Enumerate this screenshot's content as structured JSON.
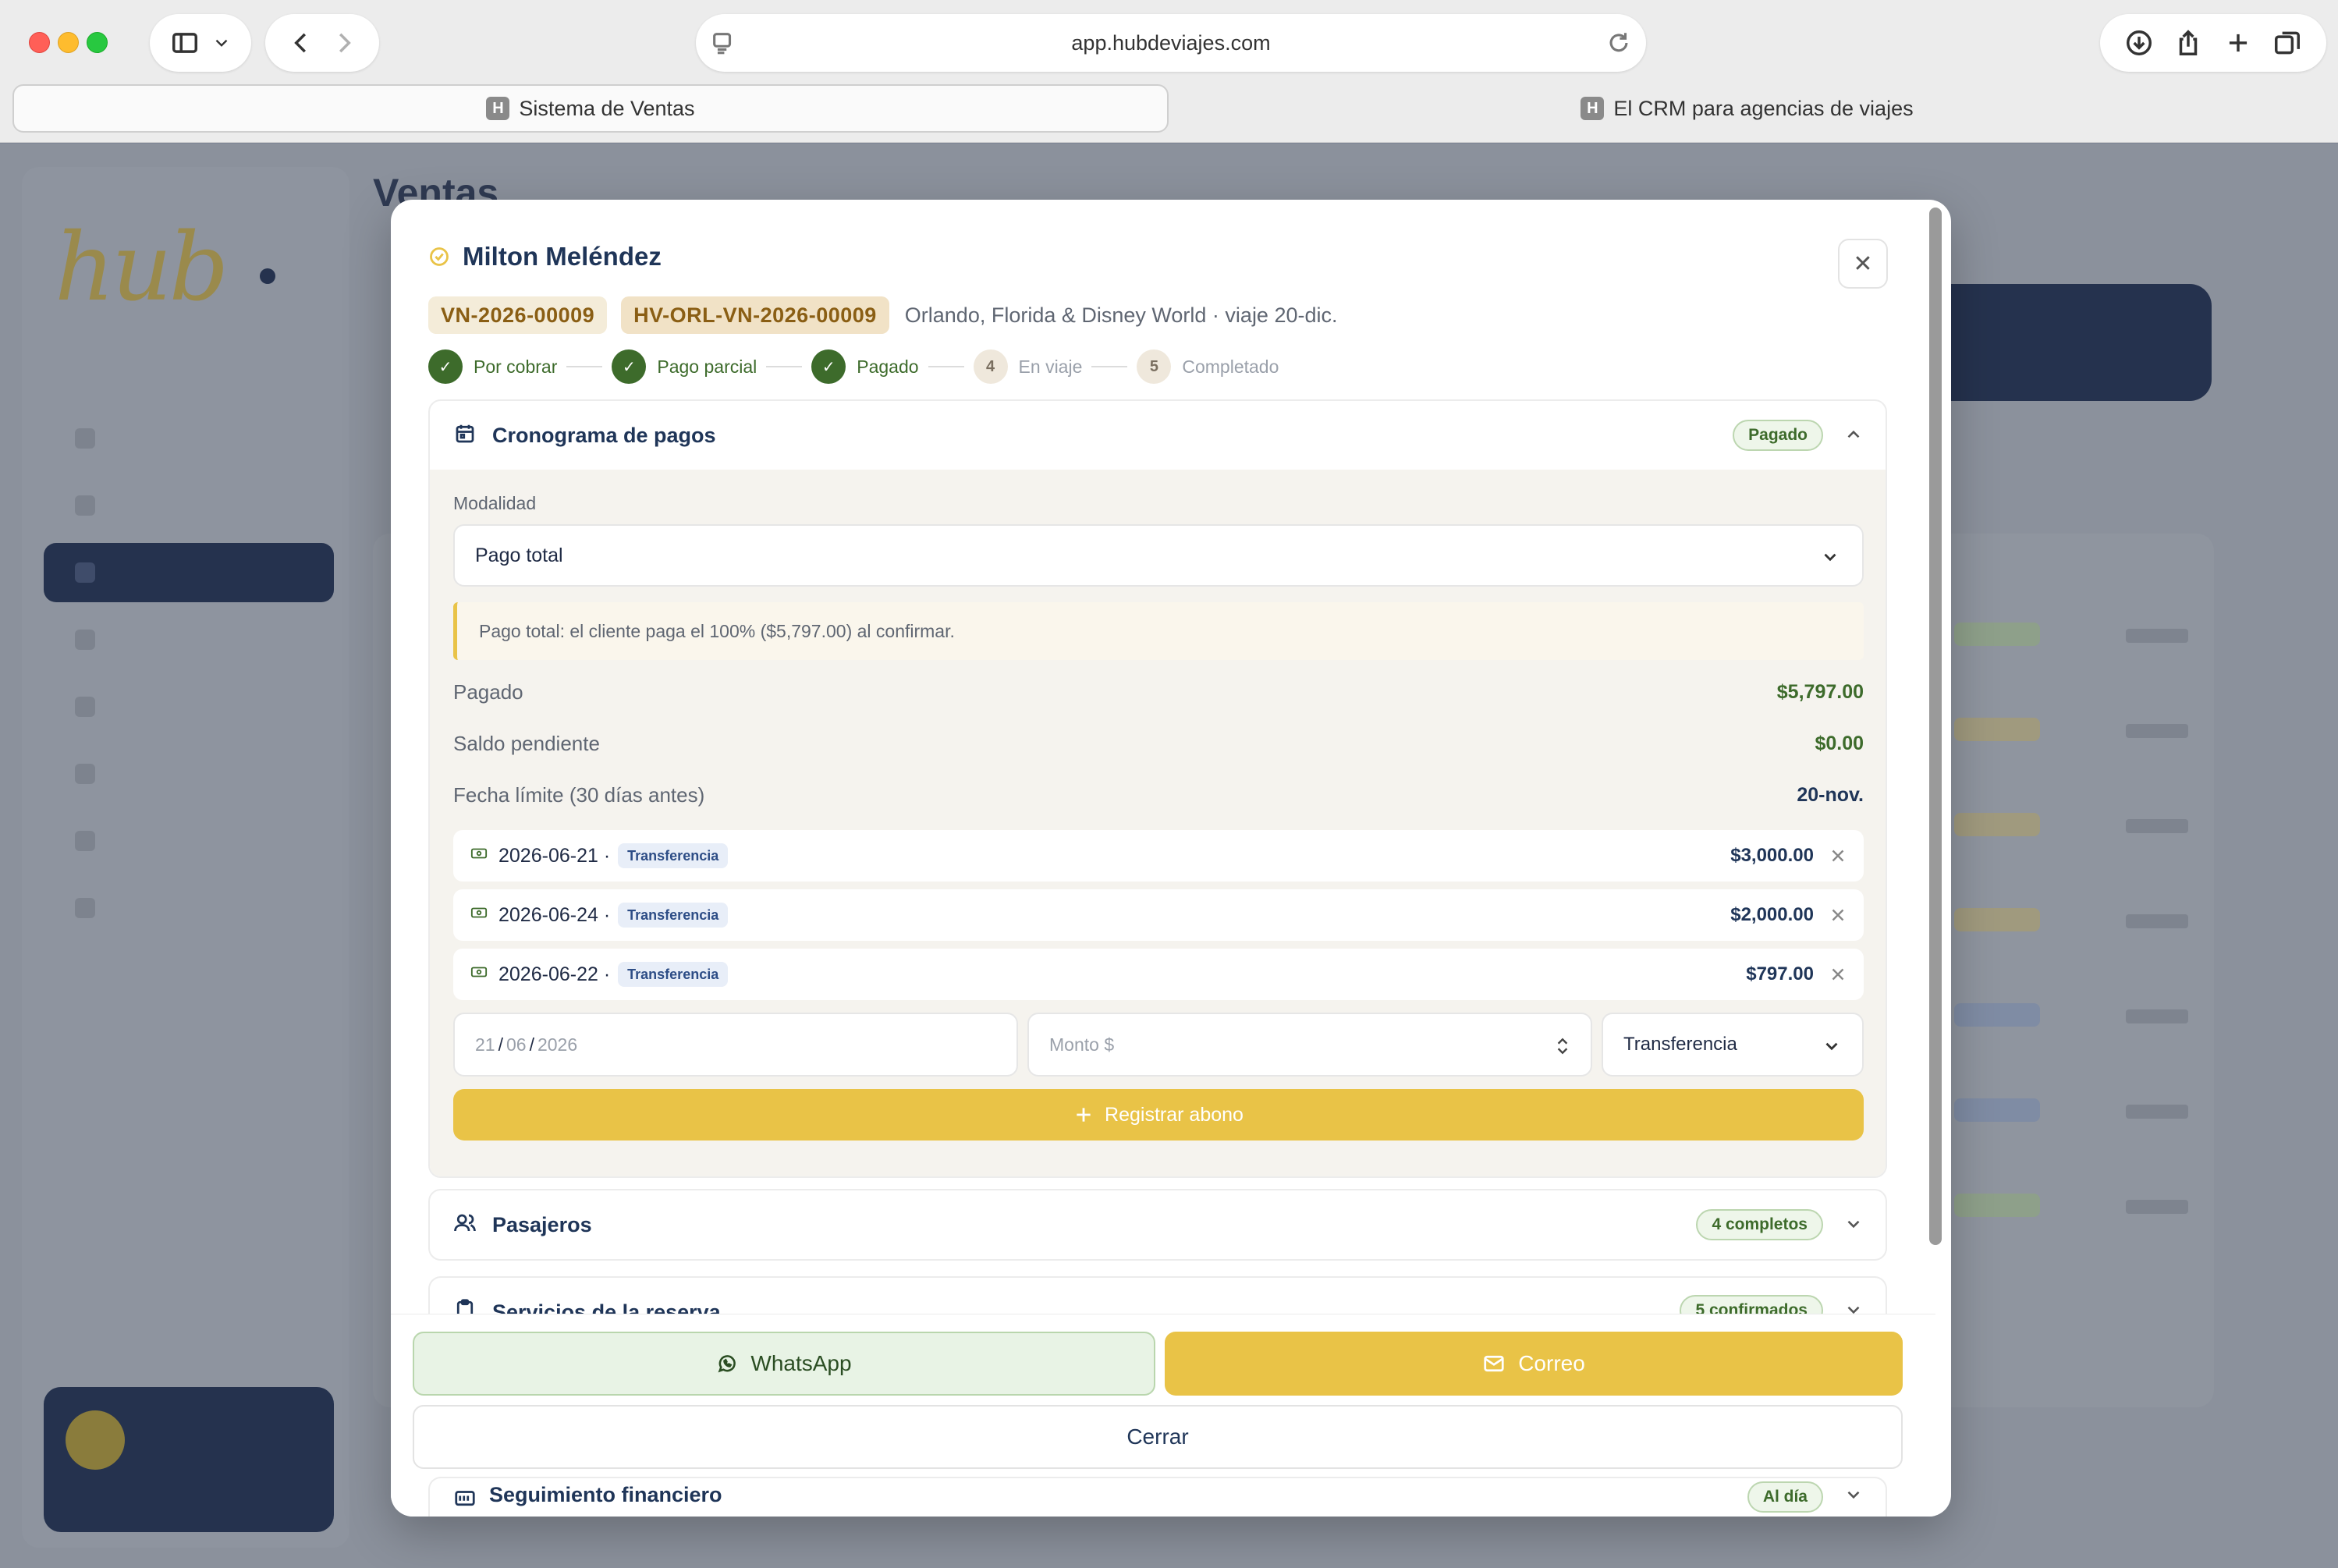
{
  "browser": {
    "url": "app.hubdeviajes.com",
    "tabs": [
      {
        "label": "Sistema de Ventas",
        "favicon": "H"
      },
      {
        "label": "El CRM para agencias de viajes",
        "favicon": "H"
      }
    ]
  },
  "background_app": {
    "logo_text": "hub",
    "page_title": "Ventas",
    "accent": "#25324e",
    "gold": "#e9c347"
  },
  "modal": {
    "client_name": "Milton Meléndez",
    "codes": [
      "VN-2026-00009",
      "HV-ORL-VN-2026-00009"
    ],
    "trip_description": "Orlando, Florida & Disney World · viaje 20-dic.",
    "steps": [
      {
        "number": "1",
        "label": "Por cobrar",
        "state": "done"
      },
      {
        "number": "2",
        "label": "Pago parcial",
        "state": "done"
      },
      {
        "number": "3",
        "label": "Pagado",
        "state": "done"
      },
      {
        "number": "4",
        "label": "En viaje",
        "state": "todo"
      },
      {
        "number": "5",
        "label": "Completado",
        "state": "todo"
      }
    ],
    "schedule": {
      "title": "Cronograma de pagos",
      "badge": "Pagado",
      "modality_label": "Modalidad",
      "modality_value": "Pago total",
      "note": "Pago total: el cliente paga el 100% ($5,797.00) al confirmar.",
      "paid_label": "Pagado",
      "paid_value": "$5,797.00",
      "balance_label": "Saldo pendiente",
      "balance_value": "$0.00",
      "deadline_label": "Fecha límite (30 días antes)",
      "deadline_value": "20-nov.",
      "payments": [
        {
          "date": "2026-06-21 ·",
          "method": "Transferencia",
          "amount": "$3,000.00"
        },
        {
          "date": "2026-06-24 ·",
          "method": "Transferencia",
          "amount": "$2,000.00"
        },
        {
          "date": "2026-06-22 ·",
          "method": "Transferencia",
          "amount": "$797.00"
        }
      ],
      "new_payment": {
        "date_day": "21",
        "date_month": "06",
        "date_year": "2026",
        "amount_placeholder": "Monto $",
        "method": "Transferencia"
      },
      "register_label": "Registrar abono"
    },
    "passengers": {
      "title": "Pasajeros",
      "badge": "4 completos"
    },
    "services": {
      "title": "Servicios de la reserva",
      "badge": "5 confirmados"
    },
    "finance": {
      "title": "Seguimiento financiero",
      "badge": "Al día"
    },
    "actions": {
      "whatsapp": "WhatsApp",
      "email": "Correo",
      "close": "Cerrar"
    }
  }
}
